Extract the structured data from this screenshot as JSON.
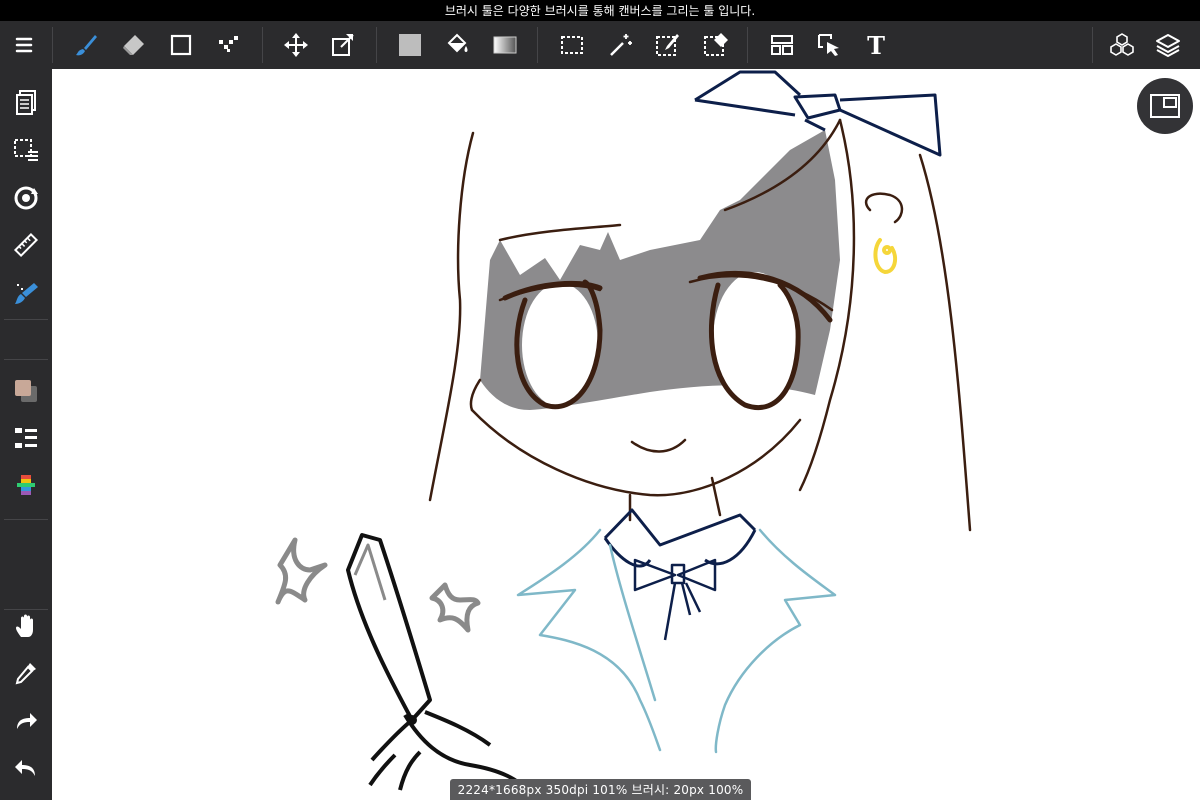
{
  "hint_bar": {
    "text": "브러시 툴은 다양한 브러시를 통해 캔버스를 그리는 툴 입니다."
  },
  "toolbar": {
    "tools": [
      {
        "name": "menu-icon"
      },
      {
        "name": "brush-icon",
        "active": true
      },
      {
        "name": "eraser-icon"
      },
      {
        "name": "shape-rectangle-icon"
      },
      {
        "name": "smudge-icon"
      },
      {
        "name": "move-icon"
      },
      {
        "name": "transform-icon"
      },
      {
        "name": "fill-color-icon"
      },
      {
        "name": "bucket-icon"
      },
      {
        "name": "gradient-icon"
      },
      {
        "name": "selection-rect-icon"
      },
      {
        "name": "magic-wand-icon"
      },
      {
        "name": "selection-pen-icon"
      },
      {
        "name": "selection-eraser-icon"
      },
      {
        "name": "frame-divider-icon"
      },
      {
        "name": "operation-icon"
      },
      {
        "name": "text-icon"
      },
      {
        "name": "materials-icon"
      },
      {
        "name": "layers-icon"
      }
    ],
    "text_tool_glyph": "T"
  },
  "sidebar": {
    "tools": [
      {
        "name": "pages-icon"
      },
      {
        "name": "selection-menu-icon"
      },
      {
        "name": "snap-icon"
      },
      {
        "name": "ruler-icon"
      },
      {
        "name": "brush-settings-icon"
      },
      {
        "name": "color-swatch-icon"
      },
      {
        "name": "layer-list-icon"
      },
      {
        "name": "color-palette-icon"
      },
      {
        "name": "hand-icon"
      },
      {
        "name": "eyedropper-icon"
      },
      {
        "name": "redo-icon"
      },
      {
        "name": "undo-icon"
      }
    ]
  },
  "colors": {
    "ui_dark": "#2b2b2d",
    "accent_blue": "#3a8fd9",
    "fill_gray": "#bdbdbd",
    "primary_color": "#c8a898",
    "line_brown": "#3b1e10",
    "navy": "#0d1f4a",
    "light_blue": "#7fb8c8",
    "yellow": "#f5d63a"
  },
  "status_bar": {
    "text": "2224*1668px 350dpi 101% 브러시: 20px 100%"
  }
}
